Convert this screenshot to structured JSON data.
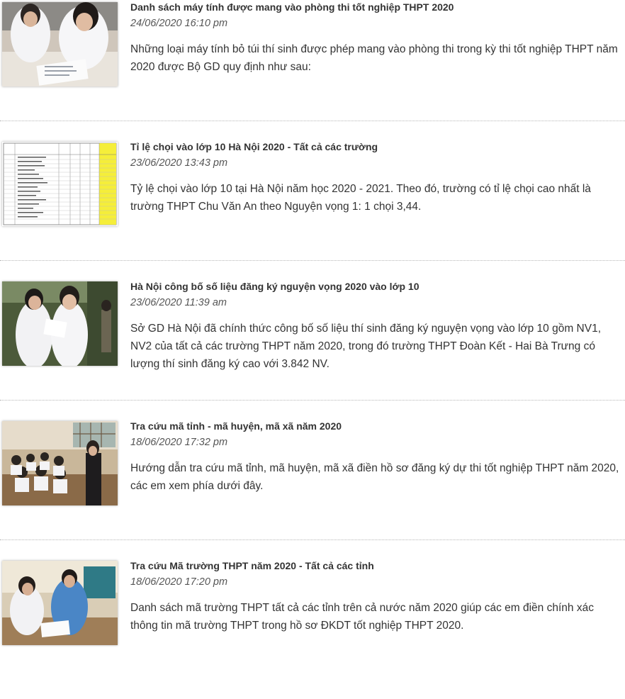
{
  "articles": [
    {
      "title": "Danh sách máy tính được mang vào phòng thi tốt nghiệp THPT 2020",
      "date": "24/06/2020 16:10 pm",
      "summary": "Những loại máy tính bỏ túi thí sinh được phép mang vào phòng thi trong kỳ thi tốt nghiệp THPT năm 2020 được Bộ GD quy định như sau:",
      "thumbnail": "students-exam-photo"
    },
    {
      "title": "Tỉ lệ chọi vào lớp 10 Hà Nội 2020 - Tất cả các trường",
      "date": "23/06/2020 13:43 pm",
      "summary": "Tỷ lệ chọi vào lớp 10 tại Hà Nội năm học 2020 - 2021. Theo đó, trường có tỉ lệ chọi cao nhất là trường THPT Chu Văn An theo Nguyện vọng 1: 1 chọi 3,44.",
      "thumbnail": "score-table-image"
    },
    {
      "title": "Hà Nội công bố số liệu đăng ký nguyện vọng 2020 vào lớp 10",
      "date": "23/06/2020 11:39 am",
      "summary": "Sở GD Hà Nội đã chính thức công bố số liệu thí sinh đăng ký nguyện vọng vào lớp 10 gồm NV1, NV2 của tất cả các trường THPT năm 2020, trong đó trường THPT Đoàn Kết - Hai Bà Trưng có lượng thí sinh đăng ký cao với 3.842 NV.",
      "thumbnail": "students-walking-photo"
    },
    {
      "title": "Tra cứu mã tỉnh - mã huyện, mã xã năm 2020",
      "date": "18/06/2020 17:32 pm",
      "summary": "Hướng dẫn tra cứu mã tỉnh, mã huyện, mã xã điền hồ sơ đăng ký dự thi tốt nghiệp THPT năm 2020, các em xem phía dưới đây.",
      "thumbnail": "classroom-photo"
    },
    {
      "title": "Tra cứu Mã trường THPT năm 2020 - Tất cả các tỉnh",
      "date": "18/06/2020 17:20 pm",
      "summary": "Danh sách mã trường THPT tất cả các tỉnh trên cả nước năm 2020 giúp các em điền chính xác thông tin mã trường THPT trong hồ sơ ĐKDT tốt nghiệp THPT 2020.",
      "thumbnail": "exam-room-photo"
    }
  ],
  "colors": {
    "text": "#333333",
    "date": "#555555",
    "divider": "#b7b7b7"
  }
}
